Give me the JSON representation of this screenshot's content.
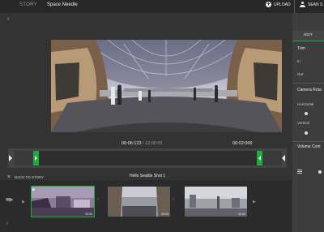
{
  "topbar": {
    "section_label": "STORY",
    "project_title": "Space Needle",
    "upload_label": "UPLOAD",
    "user_name": "SEAN S"
  },
  "player": {
    "current_time": "00:06:123",
    "separator": "/",
    "total_time": "12:00:00",
    "clip_duration": "00:02:000"
  },
  "shots": {
    "back_label": "BACK TO STORY",
    "current_shot_title": "Hello Seattle Shot 1",
    "thumbnails": [
      {
        "duration": "00:03",
        "selected": true
      },
      {
        "duration": "00:03",
        "selected": false
      },
      {
        "duration": "00:03",
        "selected": false
      }
    ]
  },
  "panel": {
    "tab_label": "EDIT",
    "trim_title": "Trim",
    "trim_in_label": "In",
    "trim_out_label": "Out",
    "rotation_title": "Camera Rota",
    "horizontal_label": "Horizontal",
    "vertical_label": "Vertical",
    "volume_title": "Volume Cont"
  },
  "colors": {
    "accent": "#1faa3e",
    "background": "#333333",
    "topbar": "#272727",
    "panel": "#3d3d3d"
  }
}
